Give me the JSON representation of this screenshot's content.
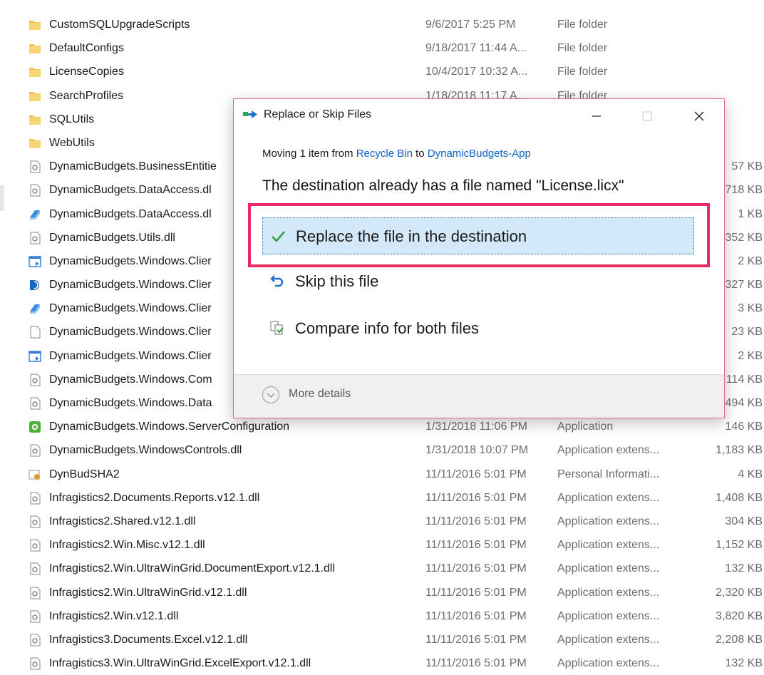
{
  "files": [
    {
      "icon": "folder-icon",
      "name": "CustomSQLUpgradeScripts",
      "date": "9/6/2017 5:25 PM",
      "type": "File folder",
      "size": ""
    },
    {
      "icon": "folder-icon",
      "name": "DefaultConfigs",
      "date": "9/18/2017 11:44 A...",
      "type": "File folder",
      "size": ""
    },
    {
      "icon": "folder-icon",
      "name": "LicenseCopies",
      "date": "10/4/2017 10:32 A...",
      "type": "File folder",
      "size": ""
    },
    {
      "icon": "folder-icon",
      "name": "SearchProfiles",
      "date": "1/18/2018 11:17 A...",
      "type": "File folder",
      "size": ""
    },
    {
      "icon": "folder-icon",
      "name": "SQLUtils",
      "date": "",
      "type": "",
      "size": ""
    },
    {
      "icon": "folder-icon",
      "name": "WebUtils",
      "date": "",
      "type": "",
      "size": ""
    },
    {
      "icon": "dll-file-icon",
      "name": "DynamicBudgets.BusinessEntitie",
      "date": "",
      "type": "",
      "size": "57 KB"
    },
    {
      "icon": "dll-file-icon",
      "name": "DynamicBudgets.DataAccess.dl",
      "date": "",
      "type": "",
      "size": "718 KB"
    },
    {
      "icon": "config-file-icon",
      "name": "DynamicBudgets.DataAccess.dl",
      "date": "",
      "type": "",
      "size": "1 KB"
    },
    {
      "icon": "dll-file-icon",
      "name": "DynamicBudgets.Utils.dll",
      "date": "",
      "type": "",
      "size": "352 KB"
    },
    {
      "icon": "shortcut-app-icon",
      "name": "DynamicBudgets.Windows.Clier",
      "date": "",
      "type": "",
      "size": "2 KB"
    },
    {
      "icon": "dynamicbudgets-app-icon",
      "name": "DynamicBudgets.Windows.Clier",
      "date": "",
      "type": "",
      "size": "327 KB"
    },
    {
      "icon": "config-file-icon",
      "name": "DynamicBudgets.Windows.Clier",
      "date": "",
      "type": "",
      "size": "3 KB"
    },
    {
      "icon": "blank-file-icon",
      "name": "DynamicBudgets.Windows.Clier",
      "date": "",
      "type": "",
      "size": "23 KB"
    },
    {
      "icon": "shortcut-app-icon",
      "name": "DynamicBudgets.Windows.Clier",
      "date": "",
      "type": "",
      "size": "2 KB"
    },
    {
      "icon": "dll-file-icon",
      "name": "DynamicBudgets.Windows.Com",
      "date": "",
      "type": "",
      "size": "114 KB"
    },
    {
      "icon": "dll-file-icon",
      "name": "DynamicBudgets.Windows.Data",
      "date": "",
      "type": "",
      "size": "494 KB"
    },
    {
      "icon": "server-config-app-icon",
      "name": "DynamicBudgets.Windows.ServerConfiguration",
      "date": "1/31/2018 11:06 PM",
      "type": "Application",
      "size": "146 KB"
    },
    {
      "icon": "dll-file-icon",
      "name": "DynamicBudgets.WindowsControls.dll",
      "date": "1/31/2018 10:07 PM",
      "type": "Application extens...",
      "size": "1,183 KB"
    },
    {
      "icon": "certificate-file-icon",
      "name": "DynBudSHA2",
      "date": "11/11/2016 5:01 PM",
      "type": "Personal Informati...",
      "size": "4 KB"
    },
    {
      "icon": "dll-file-icon",
      "name": "Infragistics2.Documents.Reports.v12.1.dll",
      "date": "11/11/2016 5:01 PM",
      "type": "Application extens...",
      "size": "1,408 KB"
    },
    {
      "icon": "dll-file-icon",
      "name": "Infragistics2.Shared.v12.1.dll",
      "date": "11/11/2016 5:01 PM",
      "type": "Application extens...",
      "size": "304 KB"
    },
    {
      "icon": "dll-file-icon",
      "name": "Infragistics2.Win.Misc.v12.1.dll",
      "date": "11/11/2016 5:01 PM",
      "type": "Application extens...",
      "size": "1,152 KB"
    },
    {
      "icon": "dll-file-icon",
      "name": "Infragistics2.Win.UltraWinGrid.DocumentExport.v12.1.dll",
      "date": "11/11/2016 5:01 PM",
      "type": "Application extens...",
      "size": "132 KB"
    },
    {
      "icon": "dll-file-icon",
      "name": "Infragistics2.Win.UltraWinGrid.v12.1.dll",
      "date": "11/11/2016 5:01 PM",
      "type": "Application extens...",
      "size": "2,320 KB"
    },
    {
      "icon": "dll-file-icon",
      "name": "Infragistics2.Win.v12.1.dll",
      "date": "11/11/2016 5:01 PM",
      "type": "Application extens...",
      "size": "3,820 KB"
    },
    {
      "icon": "dll-file-icon",
      "name": "Infragistics3.Documents.Excel.v12.1.dll",
      "date": "11/11/2016 5:01 PM",
      "type": "Application extens...",
      "size": "2,208 KB"
    },
    {
      "icon": "dll-file-icon",
      "name": "Infragistics3.Win.UltraWinGrid.ExcelExport.v12.1.dll",
      "date": "11/11/2016 5:01 PM",
      "type": "Application extens...",
      "size": "132 KB"
    }
  ],
  "dialog": {
    "title": "Replace or Skip Files",
    "minimize_icon": "minimize-icon",
    "maximize_icon": "maximize-icon",
    "close_icon": "close-icon",
    "moving_prefix": "Moving 1 item from ",
    "source": "Recycle Bin",
    "moving_mid": " to ",
    "destination": "DynamicBudgets-App",
    "heading": "The destination already has a file named \"License.licx\"",
    "options": {
      "replace": "Replace the file in the destination",
      "skip": "Skip this file",
      "compare": "Compare info for both files"
    },
    "more_details": "More details"
  },
  "colors": {
    "link": "#0f63c8",
    "selected_option_bg": "#d3e8f9",
    "highlight_border": "#ea2a65",
    "folder": "#f0c64a"
  }
}
